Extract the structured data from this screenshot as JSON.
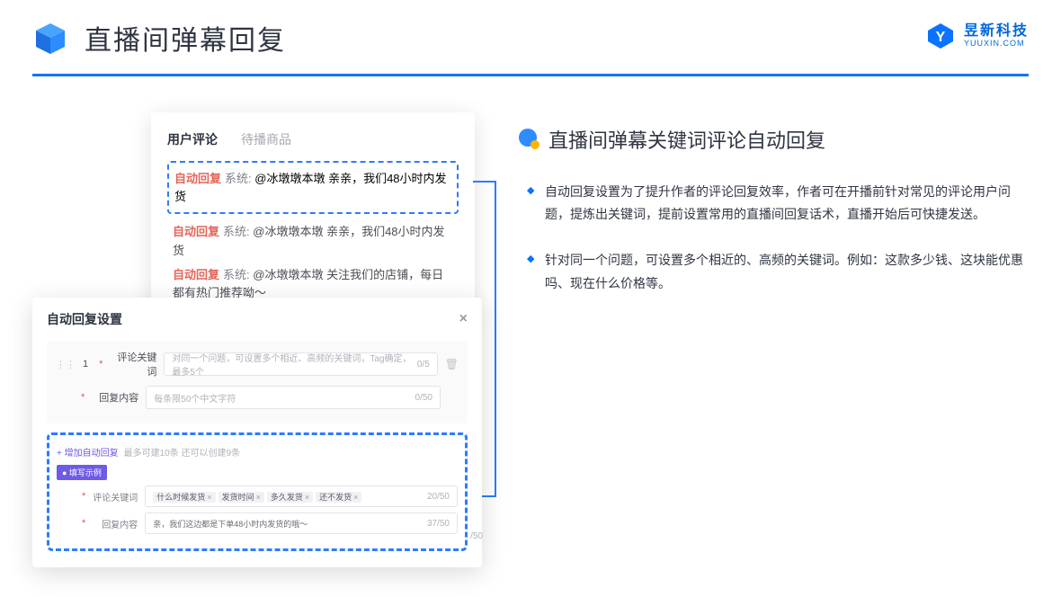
{
  "header": {
    "title": "直播间弹幕回复"
  },
  "brand": {
    "cn": "昱新科技",
    "en": "YUUXIN.COM"
  },
  "tabs": {
    "active": "用户评论",
    "inactive": "待播商品"
  },
  "highlight": {
    "tag": "自动回复",
    "sys": "系统:",
    "body": "@冰墩墩本墩 亲亲，我们48小时内发货"
  },
  "c2": {
    "tag": "自动回复",
    "sys": "系统:",
    "body": "@冰墩墩本墩 亲亲，我们48小时内发货"
  },
  "c3": {
    "tag": "自动回复",
    "sys": "系统:",
    "body": "@冰墩墩本墩 关注我们的店铺，每日都有热门推荐呦～"
  },
  "modal": {
    "title": "自动回复设置",
    "num": "1",
    "label_kw": "评论关键词",
    "ph_kw": "对同一个问题，可设置多个相近、高频的关键词，Tag确定，最多5个",
    "count_kw": "0/5",
    "label_content": "回复内容",
    "ph_content": "每条限50个中文字符",
    "count_content": "0/50",
    "add_link": "+ 增加自动回复",
    "add_hint": "最多可建10条 还可以创建9条",
    "fill_badge": "● 填写示例",
    "ex_kw_label": "评论关键词",
    "ex_kw_tags": [
      "什么时候发货",
      "发货时间",
      "多久发货",
      "还不发货"
    ],
    "ex_kw_count": "20/50",
    "ex_content_label": "回复内容",
    "ex_content_val": "亲，我们这边都是下单48小时内发货的哦～",
    "ex_content_count": "37/50",
    "outer_count": "/50"
  },
  "section": {
    "title": "直播间弹幕关键词评论自动回复"
  },
  "bullets": [
    "自动回复设置为了提升作者的评论回复效率，作者可在开播前针对常见的评论用户问题，提炼出关键词，提前设置常用的直播间回复话术，直播开始后可快捷发送。",
    "针对同一个问题，可设置多个相近的、高频的关键词。例如：这款多少钱、这块能优惠吗、现在什么价格等。"
  ]
}
